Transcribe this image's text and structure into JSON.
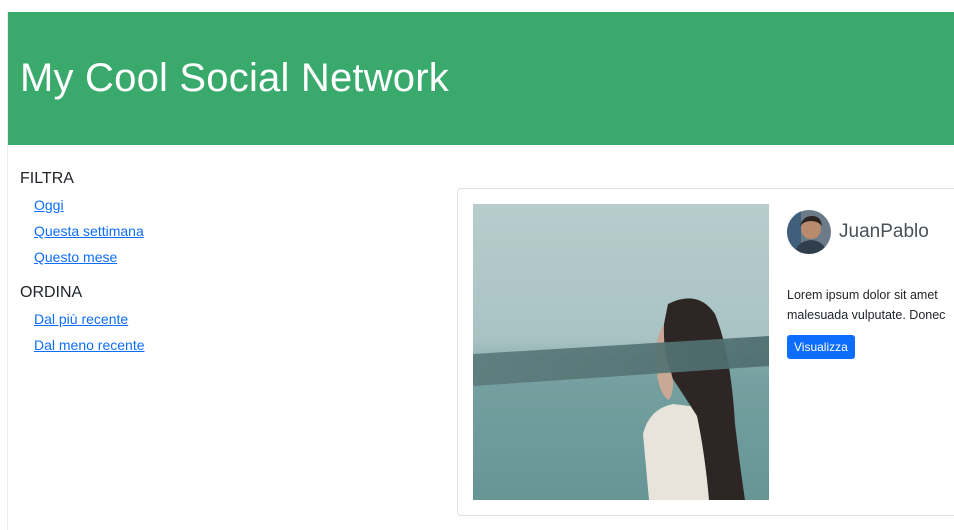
{
  "header": {
    "title": "My Cool Social Network",
    "bg_color": "#3aaa6c"
  },
  "sidebar": {
    "filter": {
      "heading": "FILTRA",
      "items": [
        {
          "label": "Oggi"
        },
        {
          "label": "Questa settimana"
        },
        {
          "label": "Questo mese"
        }
      ]
    },
    "sort": {
      "heading": "ORDINA",
      "items": [
        {
          "label": "Dal più recente"
        },
        {
          "label": "Dal meno recente"
        }
      ]
    }
  },
  "post": {
    "author": "JuanPablo",
    "text_line1": "Lorem ipsum dolor sit amet",
    "text_line2": "malesuada vulputate. Donec",
    "button_label": "Visualizza",
    "button_color": "#0d6efd"
  }
}
